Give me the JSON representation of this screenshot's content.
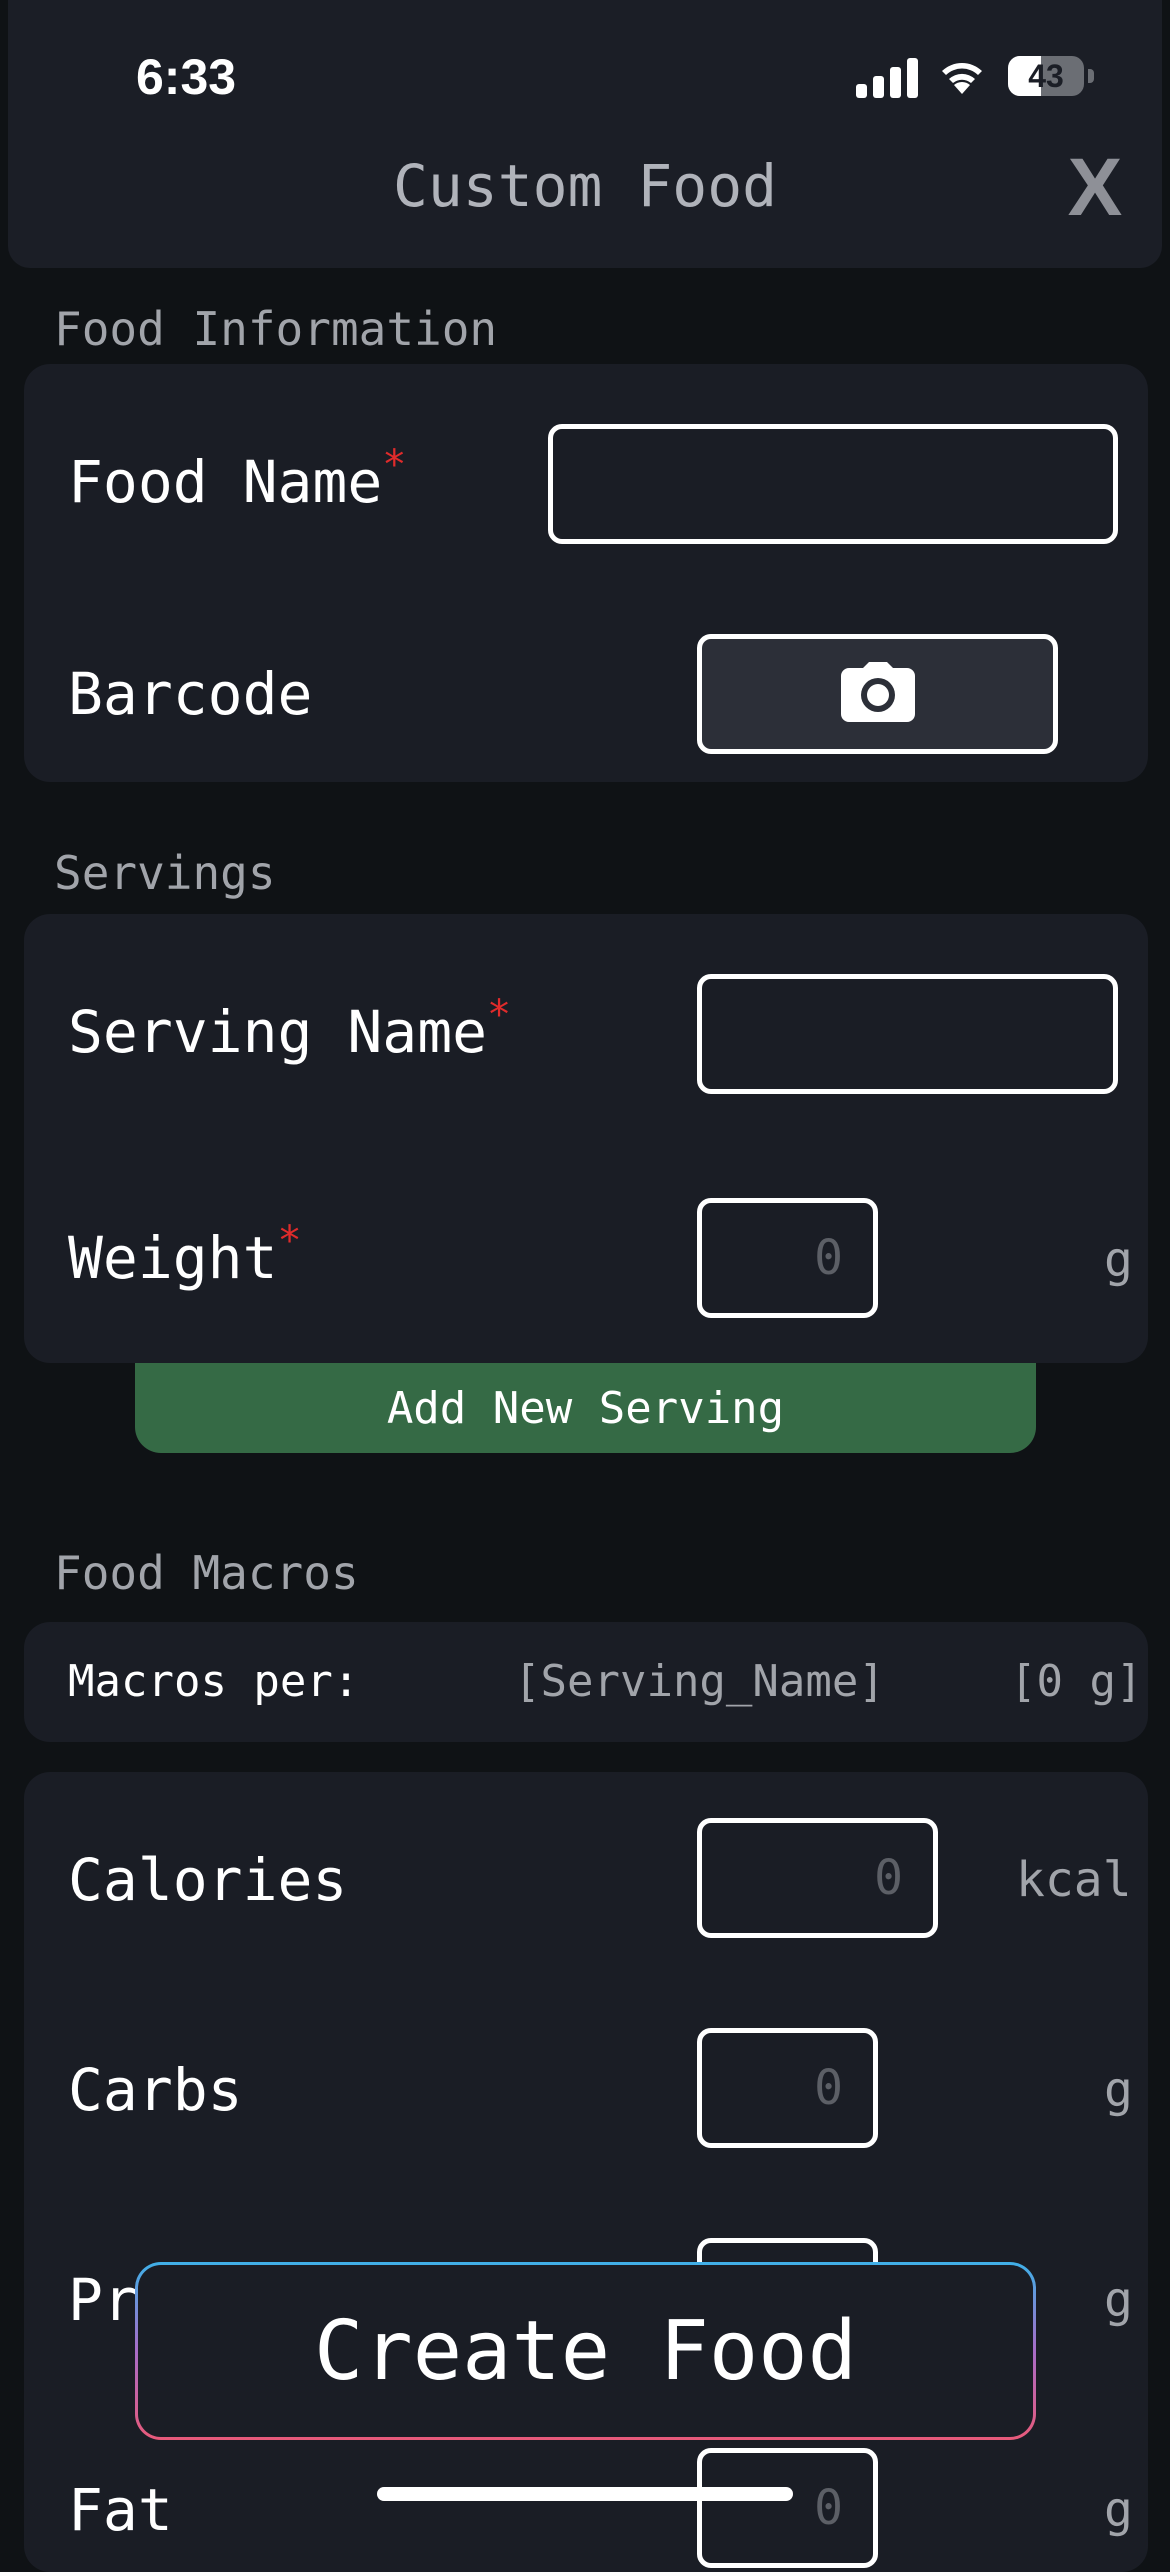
{
  "status_bar": {
    "time": "6:33",
    "battery_percent": "43",
    "battery_level": 0.43
  },
  "header": {
    "title": "Custom Food",
    "close_label": "X"
  },
  "food_information": {
    "section_title": "Food Information",
    "food_name_label": "Food Name",
    "food_name_value": "",
    "barcode_label": "Barcode",
    "required_mark": "*"
  },
  "servings": {
    "section_title": "Servings",
    "serving_name_label": "Serving Name",
    "serving_name_value": "",
    "weight_label": "Weight",
    "weight_placeholder": "0",
    "weight_unit": "g",
    "required_mark": "*",
    "add_button": "Add New Serving"
  },
  "food_macros": {
    "section_title": "Food Macros",
    "macros_per_label": "Macros per:",
    "macros_per_serving": "[Serving_Name]",
    "macros_per_weight": "[0 g]",
    "items": [
      {
        "label": "Calories",
        "placeholder": "0",
        "unit": "kcal"
      },
      {
        "label": "Carbs",
        "placeholder": "0",
        "unit": "g"
      },
      {
        "label": "Protein",
        "placeholder": "0",
        "unit": "g"
      },
      {
        "label": "Fat",
        "placeholder": "0",
        "unit": "g"
      }
    ]
  },
  "footer": {
    "create_button": "Create Food"
  },
  "colors": {
    "background": "#0f1215",
    "card": "#1a1d25",
    "accent_green": "#356a45",
    "required_red": "#e02b2b",
    "muted_text": "#a1a4aa"
  }
}
